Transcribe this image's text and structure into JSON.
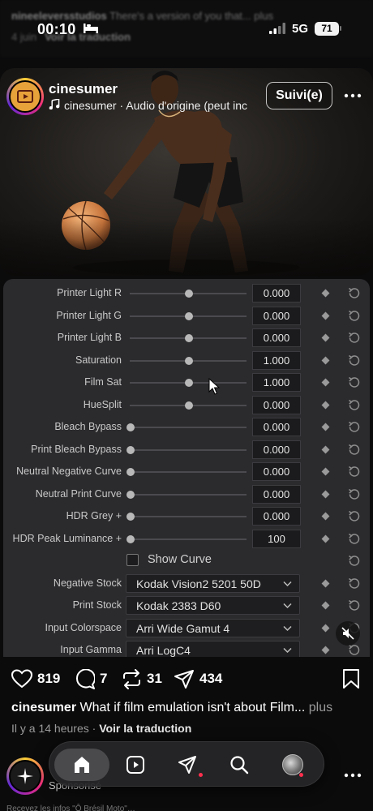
{
  "prev_post": {
    "user": "nineeleversstudios",
    "text": "There's a version of you that... plus",
    "time": "4 juin",
    "translate": "Voir la traduction"
  },
  "status_bar": {
    "time": "00:10",
    "network": "5G",
    "battery": "71"
  },
  "post": {
    "username": "cinesumer",
    "audio_line": "cinesumer · Audio d'origine  (peut inc",
    "follow_label": "Suivi(e)",
    "likes": "819",
    "comments": "7",
    "reposts": "31",
    "shares": "434",
    "caption_user": "cinesumer",
    "caption_text": "What if film emulation isn't about Film...",
    "caption_more": "plus",
    "time_ago": "Il y a 14 heures",
    "translate": "Voir la traduction"
  },
  "panel": {
    "sliders": [
      {
        "label": "Printer Light R",
        "value": "0.000",
        "position": 0.5
      },
      {
        "label": "Printer Light G",
        "value": "0.000",
        "position": 0.5
      },
      {
        "label": "Printer Light B",
        "value": "0.000",
        "position": 0.5
      },
      {
        "label": "Saturation",
        "value": "1.000",
        "position": 0.5
      },
      {
        "label": "Film Sat",
        "value": "1.000",
        "position": 0.5
      },
      {
        "label": "HueSplit",
        "value": "0.000",
        "position": 0.5
      },
      {
        "label": "Bleach Bypass",
        "value": "0.000",
        "position": 0.0
      },
      {
        "label": "Print Bleach Bypass",
        "value": "0.000",
        "position": 0.0
      },
      {
        "label": "Neutral Negative Curve",
        "value": "0.000",
        "position": 0.0
      },
      {
        "label": "Neutral Print Curve",
        "value": "0.000",
        "position": 0.0
      },
      {
        "label": "HDR Grey +",
        "value": "0.000",
        "position": 0.0
      },
      {
        "label": "HDR Peak Luminance +",
        "value": "100",
        "position": 0.0
      }
    ],
    "show_curve_label": "Show Curve",
    "dropdowns": [
      {
        "label": "Negative Stock",
        "value": "Kodak Vision2 5201 50D"
      },
      {
        "label": "Print Stock",
        "value": "Kodak 2383 D60"
      },
      {
        "label": "Input Colorspace",
        "value": "Arri Wide Gamut 4"
      },
      {
        "label": "Input Gamma",
        "value": "Arri LogC4"
      }
    ]
  },
  "next_post": {
    "sponsored": "Sponsorisé"
  },
  "footer_text": "Recevez les infos \"Ô Brésil Moto\"…",
  "colors": {
    "accent_red": "#ff2f4d",
    "panel_bg": "#2b2b2e"
  }
}
